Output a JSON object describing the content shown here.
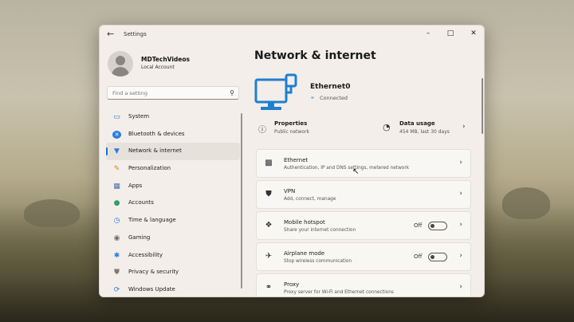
{
  "window": {
    "title": "Settings",
    "back_icon": "arrow-left-icon",
    "controls": [
      "minimize-icon",
      "maximize-icon",
      "close-icon"
    ]
  },
  "user": {
    "name": "MDTechVideos",
    "account_type": "Local Account"
  },
  "search": {
    "placeholder": "Find a setting"
  },
  "sidebar": {
    "items": [
      {
        "label": "System",
        "icon": "monitor-icon",
        "color": "#2b7de1"
      },
      {
        "label": "Bluetooth & devices",
        "icon": "bluetooth-icon",
        "color": "#2b7de1"
      },
      {
        "label": "Network & internet",
        "icon": "wifi-icon",
        "color": "#2b7de1",
        "active": true
      },
      {
        "label": "Personalization",
        "icon": "brush-icon",
        "color": "#d9822b"
      },
      {
        "label": "Apps",
        "icon": "apps-icon",
        "color": "#4a6fa5"
      },
      {
        "label": "Accounts",
        "icon": "person-icon",
        "color": "#2e9e6a"
      },
      {
        "label": "Time & language",
        "icon": "globe-clock-icon",
        "color": "#2b7de1"
      },
      {
        "label": "Gaming",
        "icon": "gamepad-icon",
        "color": "#6b6b6b"
      },
      {
        "label": "Accessibility",
        "icon": "accessibility-icon",
        "color": "#2b7de1"
      },
      {
        "label": "Privacy & security",
        "icon": "shield-icon",
        "color": "#7a7a7a"
      },
      {
        "label": "Windows Update",
        "icon": "sync-icon",
        "color": "#2b7de1"
      }
    ]
  },
  "main": {
    "title": "Network & internet",
    "adapter": {
      "name": "Ethernet0",
      "status": "Connected"
    },
    "properties": {
      "title": "Properties",
      "subtitle": "Public network"
    },
    "data_usage": {
      "title": "Data usage",
      "subtitle": "454 MB, last 30 days"
    },
    "cards": [
      {
        "title": "Ethernet",
        "subtitle": "Authentication, IP and DNS settings, metered network",
        "icon": "ethernet-icon"
      },
      {
        "title": "VPN",
        "subtitle": "Add, connect, manage",
        "icon": "vpn-shield-icon"
      },
      {
        "title": "Mobile hotspot",
        "subtitle": "Share your internet connection",
        "icon": "hotspot-icon",
        "toggle": "Off"
      },
      {
        "title": "Airplane mode",
        "subtitle": "Stop wireless communication",
        "icon": "airplane-icon",
        "toggle": "Off"
      },
      {
        "title": "Proxy",
        "subtitle": "Proxy server for Wi-Fi and Ethernet connections",
        "icon": "globe-icon"
      }
    ]
  }
}
